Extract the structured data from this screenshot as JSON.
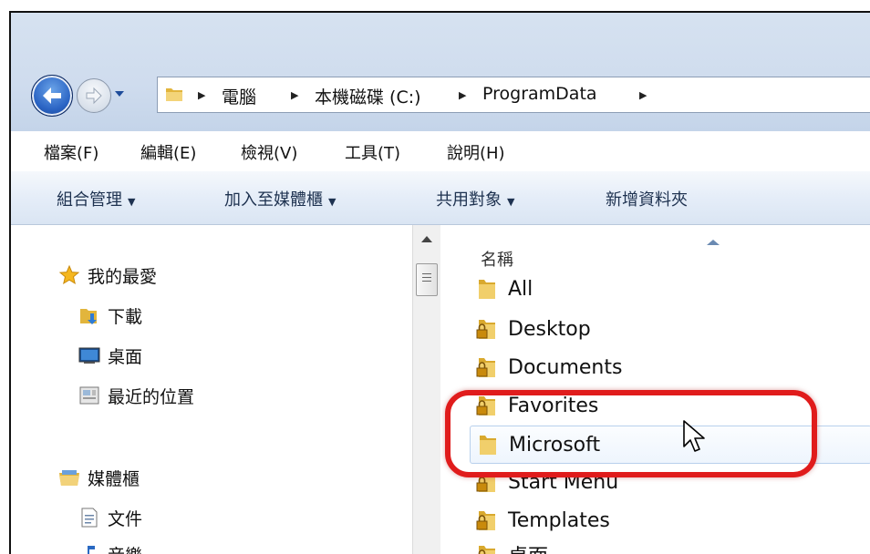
{
  "address": {
    "crumbs": [
      "電腦",
      "本機磁碟 (C:)",
      "ProgramData"
    ]
  },
  "menu": [
    "檔案(F)",
    "編輯(E)",
    "檢視(V)",
    "工具(T)",
    "說明(H)"
  ],
  "toolbar": {
    "organize": "組合管理",
    "include": "加入至媒體櫃",
    "share": "共用對象",
    "new_folder": "新增資料夾"
  },
  "nav": {
    "favorites": "我的最愛",
    "downloads": "下載",
    "desktop": "桌面",
    "recent": "最近的位置",
    "libraries": "媒體櫃",
    "documents": "文件",
    "music": "音樂"
  },
  "files": {
    "column_name": "名稱",
    "items": [
      {
        "name": "All",
        "locked": false
      },
      {
        "name": "Desktop",
        "locked": true
      },
      {
        "name": "Documents",
        "locked": true
      },
      {
        "name": "Favorites",
        "locked": true
      },
      {
        "name": "Microsoft",
        "locked": false,
        "selected": true
      },
      {
        "name": "Start Menu",
        "locked": true
      },
      {
        "name": "Templates",
        "locked": true
      },
      {
        "name": "桌面",
        "locked": true
      }
    ]
  },
  "colors": {
    "highlight": "#e01c1c",
    "folder": "#e8c24a"
  }
}
